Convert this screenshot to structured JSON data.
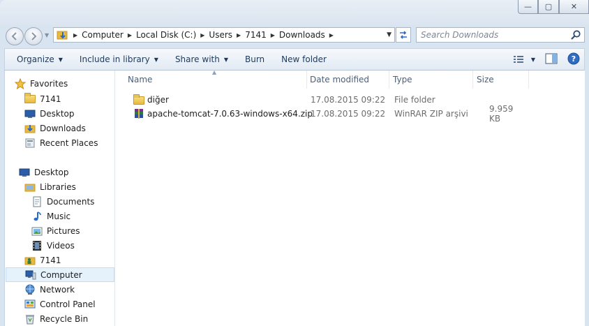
{
  "window": {
    "buttons": {
      "minimize": "—",
      "maximize": "▢",
      "close": "✕"
    }
  },
  "address": {
    "crumbs": [
      "Computer",
      "Local Disk (C:)",
      "Users",
      "7141",
      "Downloads"
    ],
    "search_placeholder": "Search Downloads"
  },
  "toolbar": {
    "organize": "Organize",
    "include_in_library": "Include in library",
    "share_with": "Share with",
    "burn": "Burn",
    "new_folder": "New folder"
  },
  "nav": {
    "favorites": "Favorites",
    "favorites_items": [
      "7141",
      "Desktop",
      "Downloads",
      "Recent Places"
    ],
    "desktop": "Desktop",
    "libraries": "Libraries",
    "library_items": [
      "Documents",
      "Music",
      "Pictures",
      "Videos"
    ],
    "user": "7141",
    "computer": "Computer",
    "network": "Network",
    "control_panel": "Control Panel",
    "recycle_bin": "Recycle Bin"
  },
  "list": {
    "columns": {
      "name": "Name",
      "date": "Date modified",
      "type": "Type",
      "size": "Size"
    },
    "rows": [
      {
        "name": "diğer",
        "date": "17.08.2015 09:22",
        "type": "File folder",
        "size": ""
      },
      {
        "name": "apache-tomcat-7.0.63-windows-x64.zip",
        "date": "17.08.2015 09:22",
        "type": "WinRAR ZIP arşivi",
        "size": "9.959 KB"
      }
    ]
  }
}
